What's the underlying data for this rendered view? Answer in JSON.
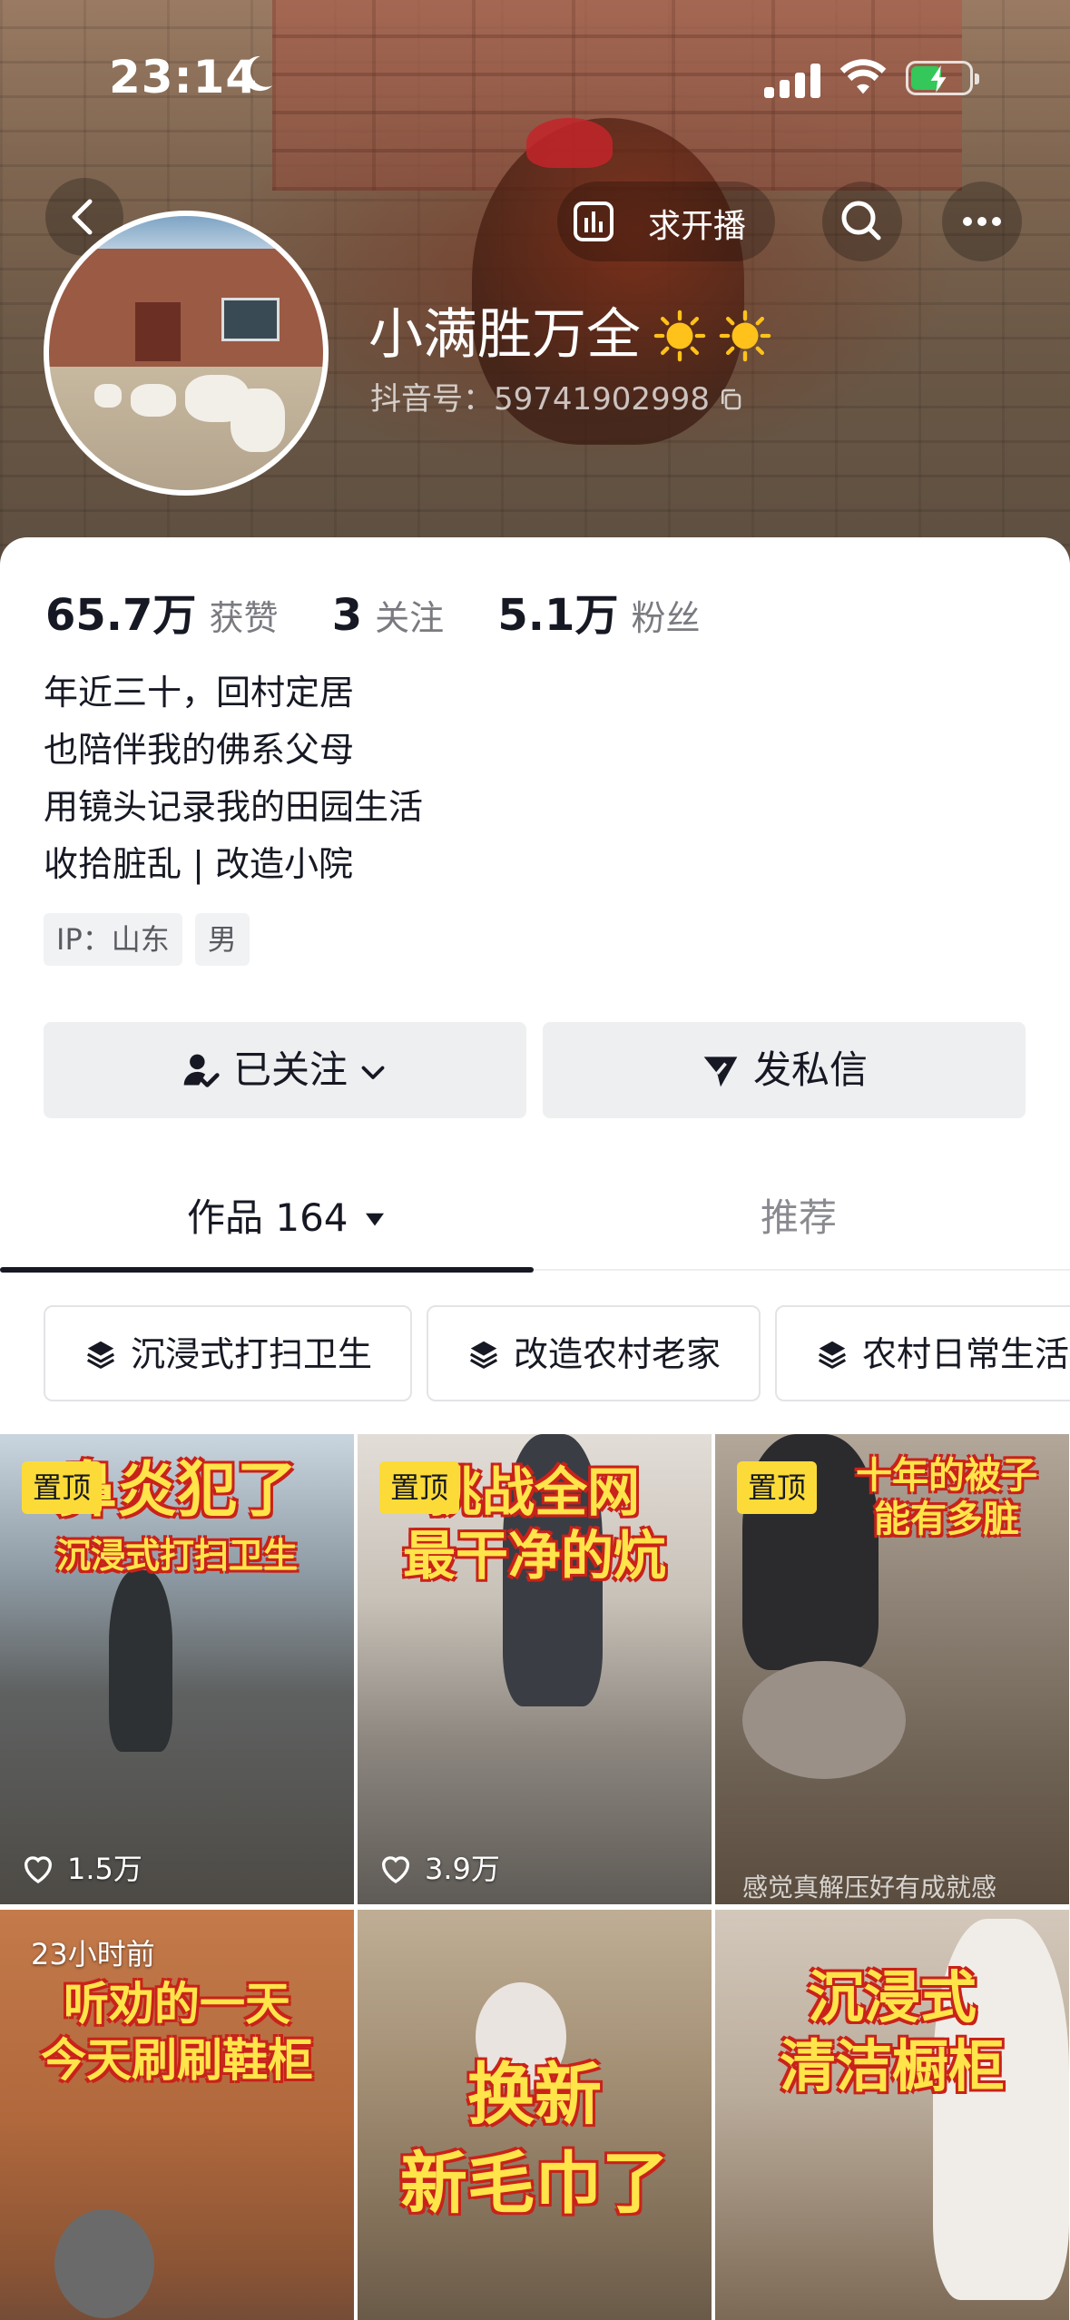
{
  "status_bar": {
    "time": "23:14"
  },
  "nav": {
    "live_request_label": "求开播"
  },
  "profile": {
    "nickname": "小满胜万全",
    "douyin_id": "抖音号：59741902998",
    "stats": [
      {
        "value": "65.7万",
        "label": "获赞"
      },
      {
        "value": "3",
        "label": "关注"
      },
      {
        "value": "5.1万",
        "label": "粉丝"
      }
    ],
    "bio": [
      "年近三十，回村定居",
      "也陪伴我的佛系父母",
      "用镜头记录我的田园生活",
      "收拾脏乱 | 改造小院"
    ],
    "tags": [
      "IP：山东",
      "男"
    ]
  },
  "actions": {
    "follow_label": "已关注",
    "message_label": "发私信"
  },
  "tabs": {
    "works_label": "作品 164",
    "recommend_label": "推荐"
  },
  "collections": [
    "沉浸式打扫卫生",
    "改造农村老家",
    "农村日常生活"
  ],
  "videos": [
    {
      "pinned_label": "置顶",
      "caption_main": "鼻炎犯了",
      "caption_sub": "沉浸式打扫卫生",
      "likes": "1.5万"
    },
    {
      "pinned_label": "置顶",
      "caption_main": "挑战全网",
      "caption_sub": "最干净的炕",
      "likes": "3.9万"
    },
    {
      "pinned_label": "置顶",
      "caption_main": "十年的被子",
      "caption_sub": "能有多脏",
      "bottom_text": "感觉真解压好有成就感"
    },
    {
      "time_ago": "23小时前",
      "caption_main": "听劝的一天",
      "caption_sub": "今天刷刷鞋柜"
    },
    {
      "caption_main": "换新",
      "caption_sub": "新毛巾了"
    },
    {
      "caption_main": "沉浸式",
      "caption_sub": "清洁橱柜"
    }
  ],
  "colors": {
    "accent_yellow": "#fcdb38",
    "caption_red": "#c9221a",
    "battery_green": "#34c759"
  }
}
